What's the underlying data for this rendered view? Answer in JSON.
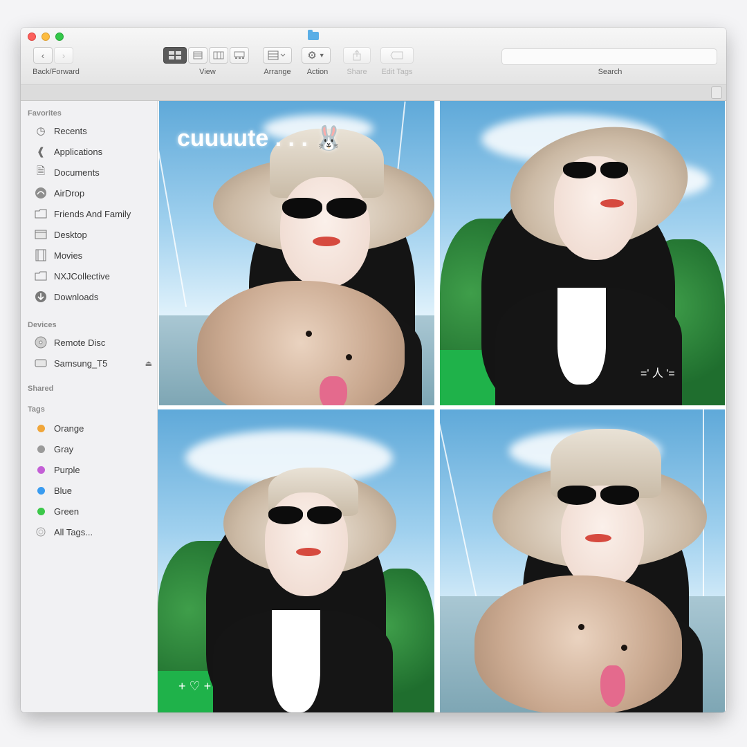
{
  "toolbar": {
    "back_forward_label": "Back/Forward",
    "view_label": "View",
    "arrange_label": "Arrange",
    "action_label": "Action",
    "share_label": "Share",
    "edit_tags_label": "Edit Tags",
    "search_label": "Search"
  },
  "sidebar": {
    "favorites_header": "Favorites",
    "favorites": [
      {
        "label": "Recents",
        "icon": "clock-icon"
      },
      {
        "label": "Applications",
        "icon": "applications-icon"
      },
      {
        "label": "Documents",
        "icon": "documents-icon"
      },
      {
        "label": "AirDrop",
        "icon": "airdrop-icon"
      },
      {
        "label": "Friends And Family",
        "icon": "folder-icon"
      },
      {
        "label": "Desktop",
        "icon": "desktop-icon"
      },
      {
        "label": "Movies",
        "icon": "movies-icon"
      },
      {
        "label": "NXJCollective",
        "icon": "folder-icon"
      },
      {
        "label": "Downloads",
        "icon": "downloads-icon"
      }
    ],
    "devices_header": "Devices",
    "devices": [
      {
        "label": "Remote Disc",
        "icon": "disc-icon"
      },
      {
        "label": "Samsung_T5",
        "icon": "drive-icon",
        "eject_icon": "eject-icon"
      }
    ],
    "shared_header": "Shared",
    "tags_header": "Tags",
    "tags": [
      {
        "label": "Orange",
        "color": "#f0a63a"
      },
      {
        "label": "Gray",
        "color": "#9a9a9a"
      },
      {
        "label": "Purple",
        "color": "#c35fd6"
      },
      {
        "label": "Blue",
        "color": "#3a9cf0"
      },
      {
        "label": "Green",
        "color": "#3cc84a"
      },
      {
        "label": "All Tags...",
        "color": ""
      }
    ]
  },
  "content": {
    "photo1_caption": "cuuuute . . . 🐰",
    "photo2_caption": "=' 人 '=",
    "photo3_caption": "+ ♡ +"
  }
}
